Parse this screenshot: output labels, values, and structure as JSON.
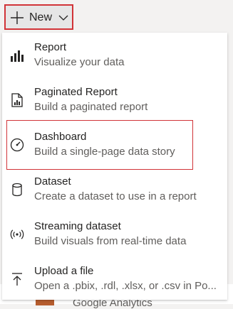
{
  "toolbar": {
    "new_label": "New",
    "new_icon": "plus-icon",
    "dropdown_icon": "chevron-down-icon",
    "highlight_color": "#d13438"
  },
  "menu": {
    "items": [
      {
        "title": "Report",
        "description": "Visualize your data",
        "icon": "bar-chart-icon"
      },
      {
        "title": "Paginated Report",
        "description": "Build a paginated report",
        "icon": "paginated-report-icon"
      },
      {
        "title": "Dashboard",
        "description": "Build a single-page data story",
        "icon": "gauge-icon"
      },
      {
        "title": "Dataset",
        "description": "Create a dataset to use in a report",
        "icon": "database-icon"
      },
      {
        "title": "Streaming dataset",
        "description": "Build visuals from real-time data",
        "icon": "broadcast-icon"
      },
      {
        "title": "Upload a file",
        "description": "Open a .pbix, .rdl, .xlsx, or .csv in Po...",
        "icon": "upload-icon"
      }
    ]
  },
  "background": {
    "partial_item_text": "Google Analytics"
  }
}
